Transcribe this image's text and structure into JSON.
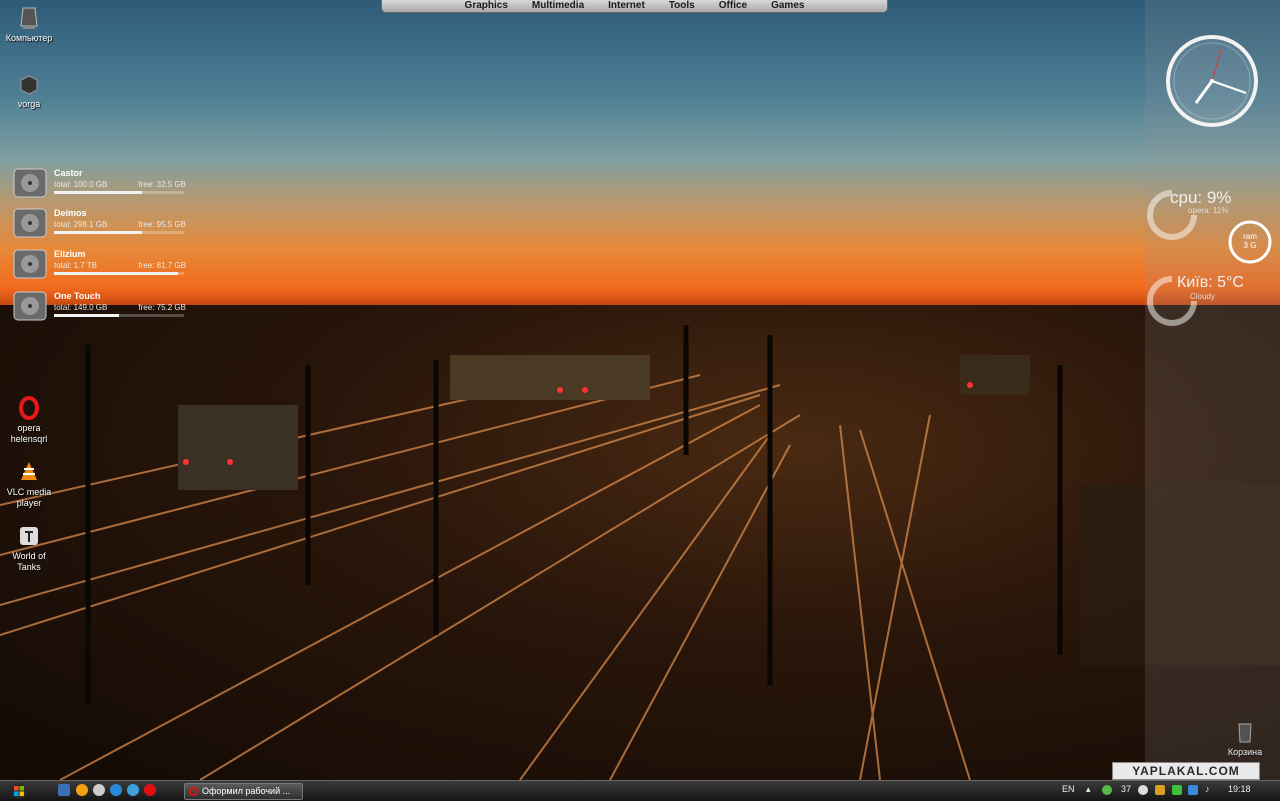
{
  "top_menu": [
    "Graphics",
    "Multimedia",
    "Internet",
    "Tools",
    "Office",
    "Games"
  ],
  "desktop_icons": [
    {
      "label": "Компьютер",
      "icon": "computer-icon"
    },
    {
      "label": "vorga",
      "icon": "cube-icon"
    },
    {
      "label": "opera helensqrl",
      "icon": "opera-icon"
    },
    {
      "label": "VLC media player",
      "icon": "vlc-icon"
    },
    {
      "label": "World of Tanks",
      "icon": "tank-icon"
    },
    {
      "label": "Корзина",
      "icon": "recycle-bin-icon"
    }
  ],
  "drives": [
    {
      "name": "Castor",
      "total": "total:  100.0 GB",
      "free": "free:  32.5 GB",
      "used_fraction": 0.68
    },
    {
      "name": "Deimos",
      "total": "total:  298.1 GB",
      "free": "free:  95.5 GB",
      "used_fraction": 0.68
    },
    {
      "name": "Elizium",
      "total": "total:  1.7 TB",
      "free": "free:  81.7 GB",
      "used_fraction": 0.95
    },
    {
      "name": "One Touch",
      "total": "total:  149.0 GB",
      "free": "free:  75.2 GB",
      "used_fraction": 0.5
    }
  ],
  "gadgets": {
    "cpu": "cpu: 9%",
    "cpu_sub": "opera: 11%",
    "ram_label": "ram",
    "ram_value": "3 G",
    "weather": "Київ: 5°C",
    "weather_sub": "Cloudy"
  },
  "watermark": "YAPLAKAL.COM",
  "taskbar": {
    "task_label": "Оформил рабочий ...",
    "lang": "EN",
    "tray_count": "37",
    "time": "19:18"
  },
  "colors": {
    "taskbar": "#1e1e1e",
    "sky_top": "#2e5a78",
    "sunset": "#f26a1c"
  }
}
